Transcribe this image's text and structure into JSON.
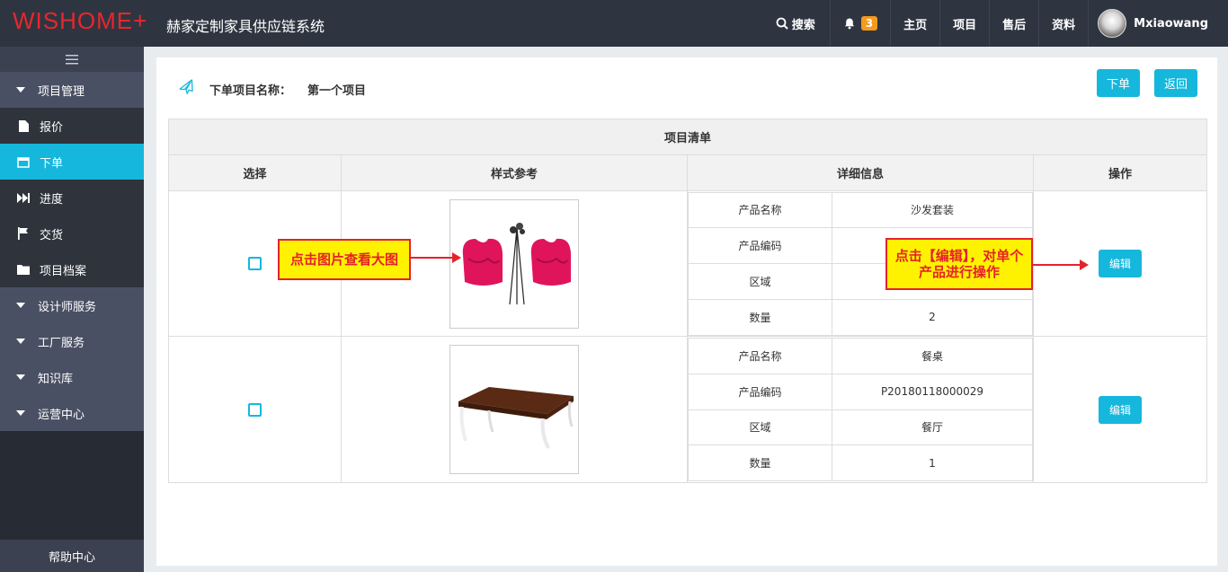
{
  "header": {
    "logo": "WISHOME+",
    "system_title": "赫家定制家具供应链系统",
    "nav": {
      "search_label": "搜索",
      "notifications_count": "3",
      "home_label": "主页",
      "project_label": "项目",
      "aftersale_label": "售后",
      "info_label": "资料",
      "username": "Mxiaowang"
    }
  },
  "sidebar": {
    "items": [
      {
        "label": "项目管理",
        "icon": "caret-down-icon"
      },
      {
        "label": "报价",
        "icon": "file-icon"
      },
      {
        "label": "下单",
        "icon": "calendar-icon",
        "active": true
      },
      {
        "label": "进度",
        "icon": "fast-forward-icon"
      },
      {
        "label": "交货",
        "icon": "flag-icon"
      },
      {
        "label": "项目档案",
        "icon": "folder-icon"
      },
      {
        "label": "设计师服务",
        "icon": "caret-down-icon"
      },
      {
        "label": "工厂服务",
        "icon": "caret-down-icon"
      },
      {
        "label": "知识库",
        "icon": "caret-down-icon"
      },
      {
        "label": "运营中心",
        "icon": "caret-down-icon"
      }
    ],
    "help_label": "帮助中心"
  },
  "order": {
    "name_label": "下单项目名称：",
    "name_value": "第一个项目",
    "submit_label": "下单",
    "back_label": "返回"
  },
  "table": {
    "title": "项目清单",
    "headers": [
      "选择",
      "样式参考",
      "详细信息",
      "操作"
    ],
    "rows": [
      {
        "image": "sofa-set-image",
        "details": [
          {
            "label": "产品名称",
            "value": "沙发套装"
          },
          {
            "label": "产品编码",
            "value": ""
          },
          {
            "label": "区域",
            "value": ""
          },
          {
            "label": "数量",
            "value": "2"
          }
        ],
        "edit_label": "编辑"
      },
      {
        "image": "dining-table-image",
        "details": [
          {
            "label": "产品名称",
            "value": "餐桌"
          },
          {
            "label": "产品编码",
            "value": "P20180118000029"
          },
          {
            "label": "区域",
            "value": "餐厅"
          },
          {
            "label": "数量",
            "value": "1"
          }
        ],
        "edit_label": "编辑"
      }
    ]
  },
  "annotations": {
    "image_hint": "点击图片查看大图",
    "edit_hint": "点击【编辑】，对单个产品进行操作"
  },
  "colors": {
    "accent": "#16b7dc",
    "topbar": "#2f3540",
    "sidebar": "#272b33",
    "callout_bg": "#fff200",
    "callout_border": "#e5222a"
  }
}
